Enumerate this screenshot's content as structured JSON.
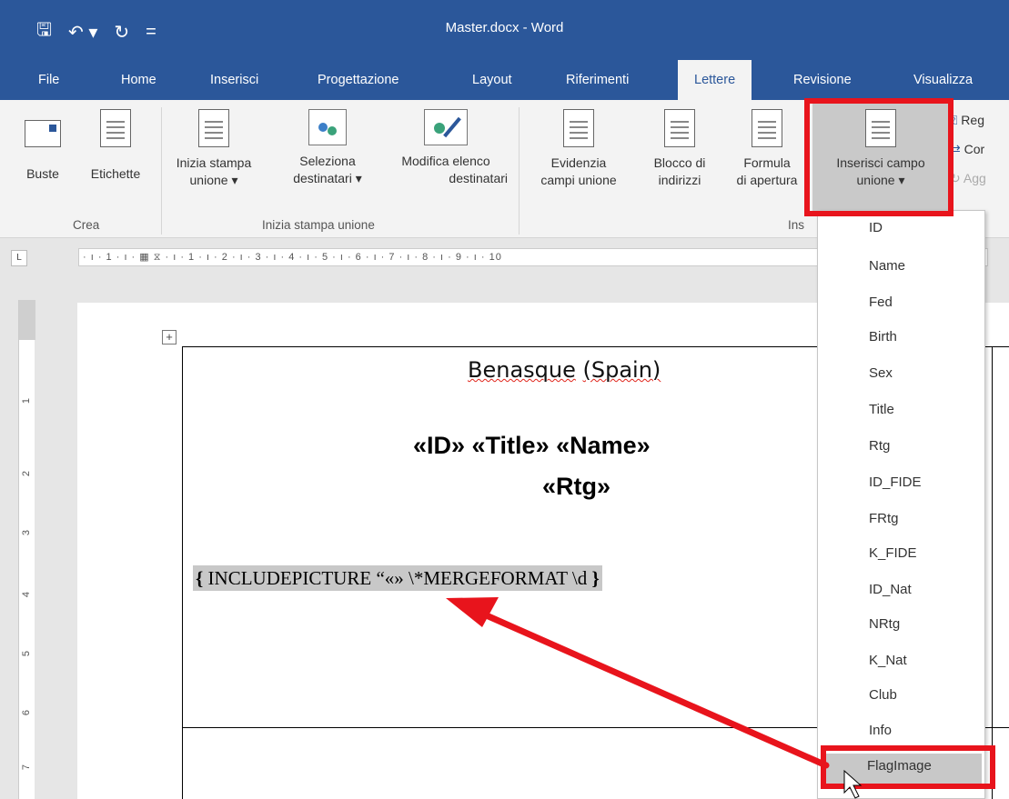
{
  "window": {
    "title": "Master.docx - Word"
  },
  "qat": {
    "save": "🖫",
    "undo": "↶ ▾",
    "redo": "↻",
    "customize": "="
  },
  "tabs": [
    "File",
    "Home",
    "Inserisci",
    "Progettazione",
    "Layout",
    "Riferimenti",
    "Lettere",
    "Revisione",
    "Visualizza"
  ],
  "active_tab": "Lettere",
  "ribbon": {
    "crea": {
      "label": "Crea",
      "buste": "Buste",
      "etichette": "Etichette"
    },
    "inizia": {
      "label": "Inizia stampa unione",
      "inizia_l1": "Inizia stampa",
      "inizia_l2": "unione ▾",
      "seleziona_l1": "Seleziona",
      "seleziona_l2": "destinatari ▾",
      "modifica_l1": "Modifica elenco",
      "modifica_l2": "destinatari"
    },
    "inserisci": {
      "label": "Ins",
      "evidenzia_l1": "Evidenzia",
      "evidenzia_l2": "campi unione",
      "blocco_l1": "Blocco di",
      "blocco_l2": "indirizzi",
      "formula_l1": "Formula",
      "formula_l2": "di apertura",
      "inserisci_l1": "Inserisci campo",
      "inserisci_l2": "unione ▾",
      "regole": "Reg",
      "corrispondenza": "Cor",
      "aggiorna": "Agg"
    }
  },
  "ruler": {
    "corner": "L",
    "marks": "· ı · 1 · ı · ▦ ⧖ · ı · 1 · ı · 2 · ı · 3 · ı · 4 · ı · 5 · ı · 6 · ı · 7 · ı · 8 · ı · 9 · ı · 10"
  },
  "vruler_ticks": [
    "1",
    "2",
    "3",
    "4",
    "5",
    "6",
    "7"
  ],
  "document": {
    "venue_a": "Benasque",
    "venue_b": "(Spain)",
    "merge_line1": "«ID» «Title» «Name»",
    "merge_line2": "«Rtg»",
    "field_open": "{",
    "field_code": "INCLUDEPICTURE “«» \\*MERGEFORMAT \\d",
    "field_close": "}"
  },
  "merge_fields": [
    "ID",
    "Name",
    "Fed",
    "Birth",
    "Sex",
    "Title",
    "Rtg",
    "ID_FIDE",
    "FRtg",
    "K_FIDE",
    "ID_Nat",
    "NRtg",
    "K_Nat",
    "Club",
    "Info",
    "FlagImage"
  ],
  "hovered_field": "FlagImage",
  "colors": {
    "word_blue": "#2b579a",
    "highlight_red": "#e8141c"
  }
}
